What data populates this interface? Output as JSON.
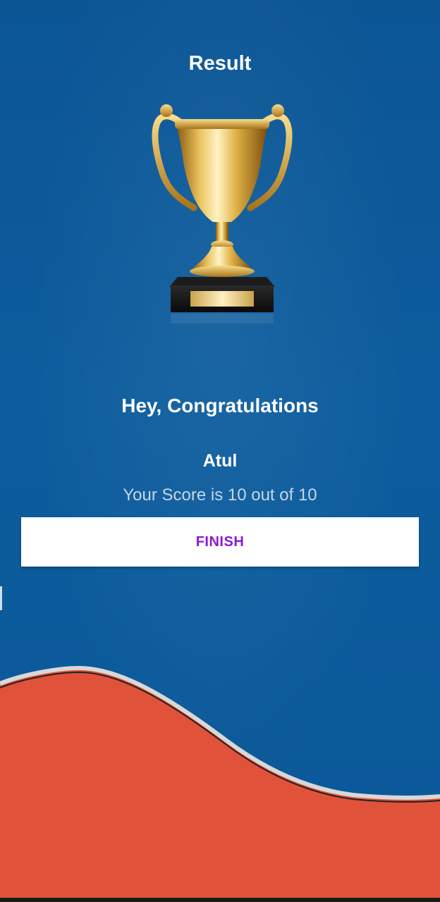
{
  "screen": {
    "title": "Result",
    "trophy_image": "trophy-icon"
  },
  "result": {
    "heading": "Hey, Congratulations",
    "player_name": "Atul",
    "score_text": "Your Score is 10 out of 10",
    "score": 10,
    "total": 10
  },
  "actions": {
    "finish_label": "FINISH"
  },
  "colors": {
    "background": "#0d5a99",
    "button_text": "#8a19d6",
    "wave_red": "#e0523a",
    "wave_border": "#d8d8d8"
  }
}
